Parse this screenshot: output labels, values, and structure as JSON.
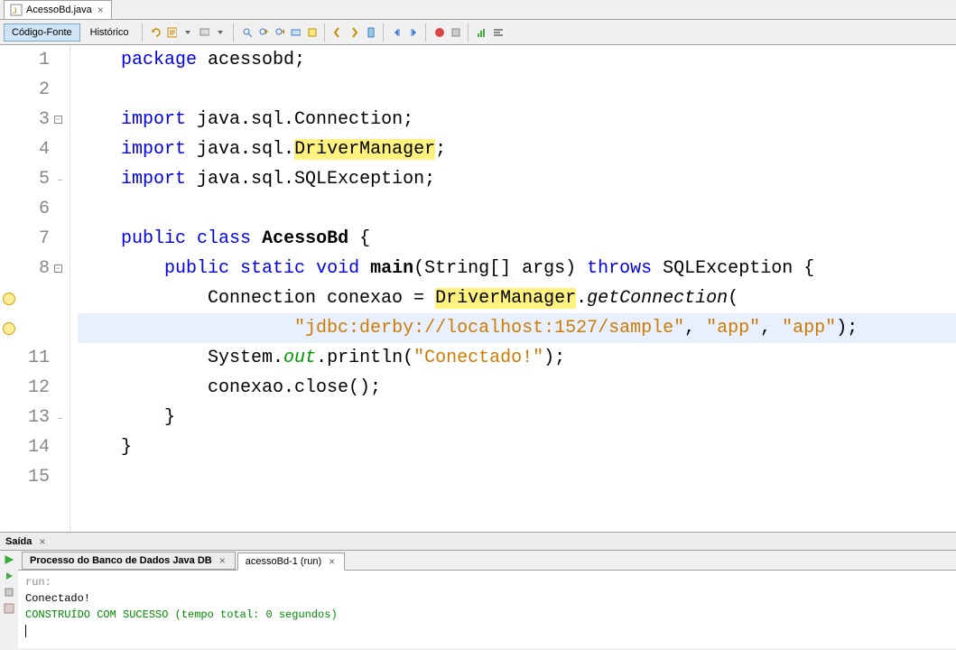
{
  "fileTab": {
    "name": "AcessoBd.java"
  },
  "toolbar": {
    "sourceBtn": "Código-Fonte",
    "historyBtn": "Histórico"
  },
  "code": {
    "lines": [
      {
        "n": "1",
        "fold": "",
        "hint": "",
        "tokens": [
          [
            "",
            "    "
          ],
          [
            "kw",
            "package"
          ],
          [
            "",
            " acessobd;"
          ]
        ]
      },
      {
        "n": "2",
        "fold": "",
        "hint": "",
        "tokens": [
          [
            "",
            ""
          ]
        ]
      },
      {
        "n": "3",
        "fold": "box",
        "hint": "",
        "tokens": [
          [
            "",
            "    "
          ],
          [
            "kw",
            "import"
          ],
          [
            "",
            " java.sql.Connection;"
          ]
        ]
      },
      {
        "n": "4",
        "fold": "line",
        "hint": "",
        "tokens": [
          [
            "",
            "    "
          ],
          [
            "kw",
            "import"
          ],
          [
            "",
            " java.sql."
          ],
          [
            "hl",
            "DriverManager"
          ],
          [
            "",
            ";"
          ]
        ]
      },
      {
        "n": "5",
        "fold": "end",
        "hint": "",
        "tokens": [
          [
            "",
            "    "
          ],
          [
            "kw",
            "import"
          ],
          [
            "",
            " java.sql.SQLException;"
          ]
        ]
      },
      {
        "n": "6",
        "fold": "",
        "hint": "",
        "tokens": [
          [
            "",
            ""
          ]
        ]
      },
      {
        "n": "7",
        "fold": "",
        "hint": "",
        "tokens": [
          [
            "",
            "    "
          ],
          [
            "kw",
            "public"
          ],
          [
            "",
            " "
          ],
          [
            "kw",
            "class"
          ],
          [
            "",
            " "
          ],
          [
            "bold",
            "AcessoBd"
          ],
          [
            "",
            " {"
          ]
        ]
      },
      {
        "n": "8",
        "fold": "box",
        "hint": "",
        "tokens": [
          [
            "",
            "        "
          ],
          [
            "kw",
            "public"
          ],
          [
            "",
            " "
          ],
          [
            "kw",
            "static"
          ],
          [
            "",
            " "
          ],
          [
            "kw",
            "void"
          ],
          [
            "",
            " "
          ],
          [
            "bold",
            "main"
          ],
          [
            "",
            "(String[] args) "
          ],
          [
            "kw",
            "throws"
          ],
          [
            "",
            " SQLException {"
          ]
        ]
      },
      {
        "n": "",
        "fold": "line",
        "hint": "bulb",
        "tokens": [
          [
            "",
            "            Connection conexao = "
          ],
          [
            "hl",
            "DriverManager"
          ],
          [
            "",
            "."
          ],
          [
            "italic",
            "getConnection"
          ],
          [
            "",
            "("
          ]
        ]
      },
      {
        "n": "",
        "fold": "line",
        "hint": "bulb",
        "current": true,
        "tokens": [
          [
            "",
            "                    "
          ],
          [
            "str",
            "\"jdbc:derby://localhost:1527/sample\""
          ],
          [
            "",
            ", "
          ],
          [
            "str",
            "\"app\""
          ],
          [
            "",
            ", "
          ],
          [
            "str",
            "\"app\""
          ],
          [
            "",
            ");"
          ]
        ]
      },
      {
        "n": "11",
        "fold": "line",
        "hint": "",
        "tokens": [
          [
            "",
            "            System."
          ],
          [
            "field",
            "out"
          ],
          [
            "",
            ".println("
          ],
          [
            "str",
            "\"Conectado!\""
          ],
          [
            "",
            ");"
          ]
        ]
      },
      {
        "n": "12",
        "fold": "line",
        "hint": "",
        "tokens": [
          [
            "",
            "            conexao.close();"
          ]
        ]
      },
      {
        "n": "13",
        "fold": "end",
        "hint": "",
        "tokens": [
          [
            "",
            "        }"
          ]
        ]
      },
      {
        "n": "14",
        "fold": "",
        "hint": "",
        "tokens": [
          [
            "",
            "    }"
          ]
        ]
      },
      {
        "n": "15",
        "fold": "",
        "hint": "",
        "tokens": [
          [
            "",
            ""
          ]
        ]
      }
    ]
  },
  "output": {
    "title": "Saída",
    "tabs": [
      {
        "label": "Processo do Banco de Dados Java DB",
        "bold": true,
        "active": false
      },
      {
        "label": "acessoBd-1 (run)",
        "bold": false,
        "active": true
      }
    ],
    "lines": [
      {
        "cls": "console-gray",
        "text": "run:"
      },
      {
        "cls": "",
        "text": "Conectado!"
      },
      {
        "cls": "console-green",
        "text": "CONSTRUÍDO COM SUCESSO (tempo total: 0 segundos)"
      }
    ]
  }
}
